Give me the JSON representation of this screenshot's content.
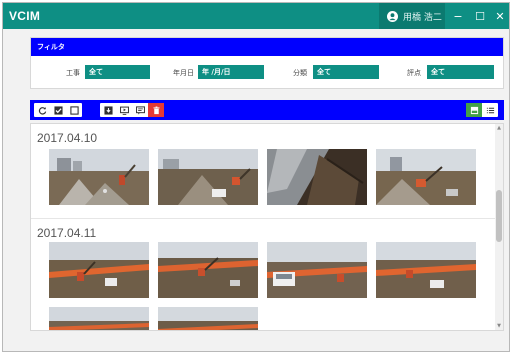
{
  "app": {
    "title": "VCIM"
  },
  "user": {
    "name": "用橋 浩二"
  },
  "window_controls": {
    "minimize": "−",
    "maximize": "☐",
    "close": "✕"
  },
  "filter": {
    "title": "フィルタ",
    "fields": [
      {
        "label": "工事",
        "value": "全て"
      },
      {
        "label": "年月日",
        "value": "年 /月/日"
      },
      {
        "label": "分類",
        "value": "全て"
      },
      {
        "label": "評点",
        "value": "全て"
      }
    ]
  },
  "toolbar": {
    "left_icons": [
      "refresh-icon",
      "check-all-icon",
      "uncheck-icon"
    ],
    "action_icons": [
      "download-icon",
      "slideshow-icon",
      "comment-icon",
      "delete-icon"
    ],
    "view_icons": [
      "grid-view-icon",
      "list-view-icon"
    ],
    "colors": {
      "bar": "#0000ff",
      "delete": "#e53935",
      "active_view": "#43a047"
    }
  },
  "gallery": {
    "groups": [
      {
        "date": "2017.04.10",
        "photo_count": 4
      },
      {
        "date": "2017.04.11",
        "photo_count": 6
      }
    ]
  },
  "colors": {
    "accent": "#0e8f84",
    "header_blue": "#0000ff"
  }
}
